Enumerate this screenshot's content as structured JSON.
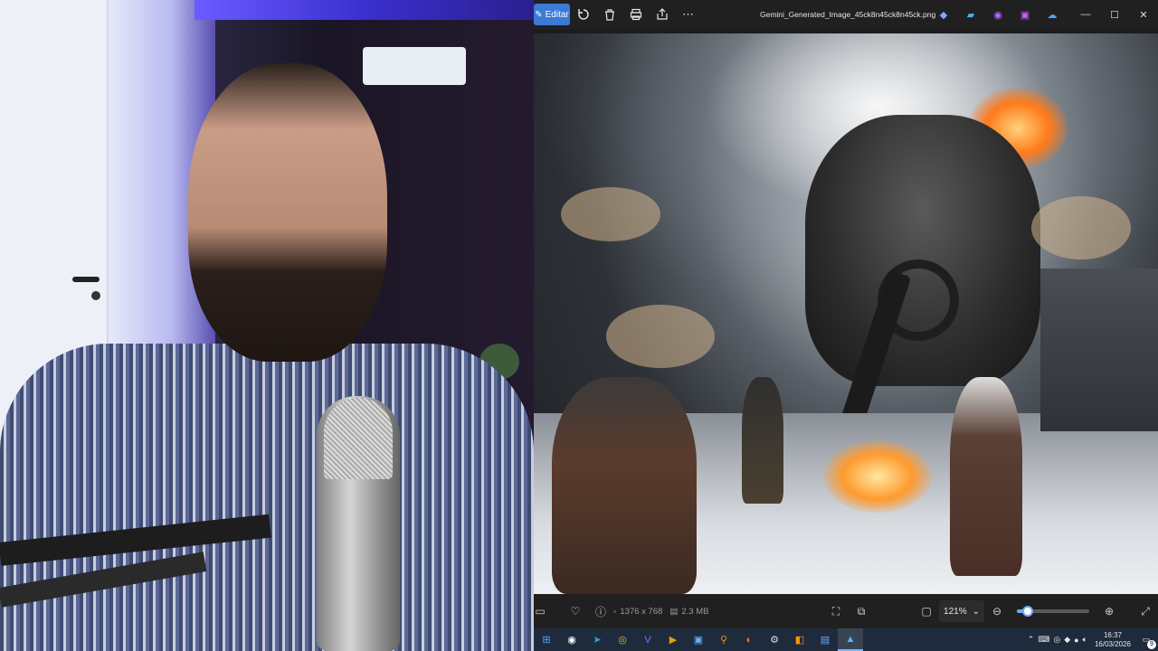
{
  "viewer": {
    "toolbar": {
      "edit_label": "Editar",
      "rotate_icon": "rotate-icon",
      "delete_icon": "trash-icon",
      "print_icon": "printer-icon",
      "share_icon": "share-icon",
      "more_icon": "more-icon"
    },
    "file_title": "Gemini_Generated_Image_45ck8n45ck8n45ck.png",
    "app_icons": [
      "copilot-icon",
      "photo-editor-icon",
      "clipchamp-icon",
      "designer-icon",
      "onedrive-icon"
    ],
    "window_controls": {
      "minimize": "—",
      "maximize": "☐",
      "close": "✕"
    },
    "bottombar": {
      "favorite_icon": "heart-icon",
      "info_icon": "info-icon",
      "dimensions": "1376 x 768",
      "file_size": "2.3 MB",
      "zoom_value": "121%",
      "zoom_percent": 121,
      "zoom_slider_fraction": 0.15
    }
  },
  "taskbar": {
    "apps": [
      "windows-start-icon",
      "obs-icon",
      "telegram-icon",
      "chrome-icon",
      "visual-studio-icon",
      "plex-icon",
      "video-editor-icon",
      "search-app-icon",
      "firefox-icon",
      "settings-app-icon",
      "sublime-icon",
      "notepad-icon",
      "photos-icon"
    ],
    "active_app": "photos-icon",
    "clock_time": "16:37",
    "clock_date": "16/03/2026",
    "notification_count": "9"
  },
  "colors": {
    "accent": "#3a7bd5",
    "titlebar": "#202020",
    "taskbar": "#1e2b3c"
  }
}
